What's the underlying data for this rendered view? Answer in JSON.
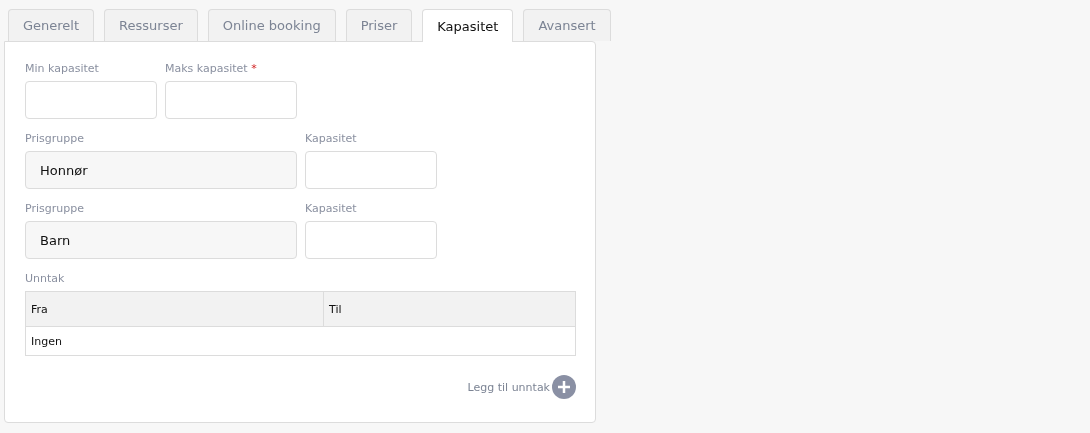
{
  "tabs": [
    {
      "label": "Generelt",
      "selected": false
    },
    {
      "label": "Ressurser",
      "selected": false
    },
    {
      "label": "Online booking",
      "selected": false
    },
    {
      "label": "Priser",
      "selected": false
    },
    {
      "label": "Kapasitet",
      "selected": true
    },
    {
      "label": "Avansert",
      "selected": false
    }
  ],
  "capacity_fields": [
    {
      "label": "Min kapasitet",
      "required": false
    },
    {
      "label": "Maks kapasitet",
      "required": true
    }
  ],
  "required_mark": "*",
  "price_groups": [
    {
      "group_label": "Prisgruppe",
      "group_value": "Honnør",
      "capacity_label": "Kapasitet"
    },
    {
      "group_label": "Prisgruppe",
      "group_value": "Barn",
      "capacity_label": "Kapasitet"
    }
  ],
  "exceptions": {
    "label": "Unntak",
    "columns": [
      "Fra",
      "Til"
    ],
    "empty_text": "Ingen"
  },
  "add_exception_button": "Legg til unntak"
}
